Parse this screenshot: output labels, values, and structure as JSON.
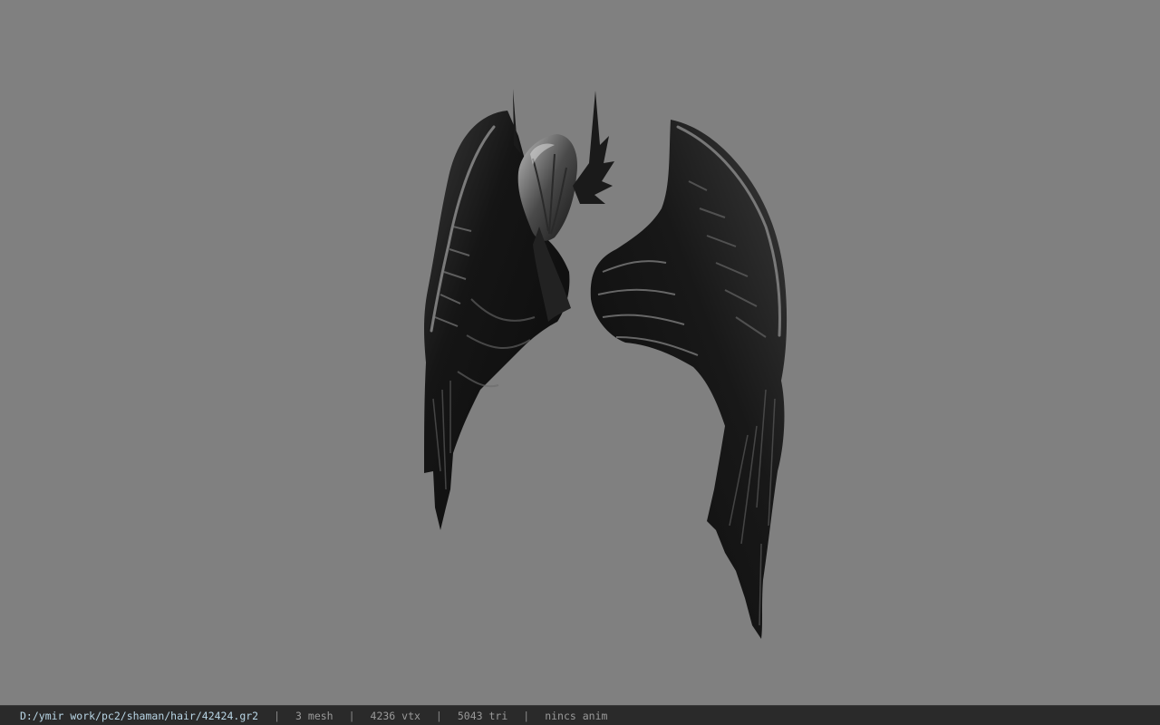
{
  "viewer": {
    "background_color": "#808080",
    "model_icon": "black-feathered-wings-with-helm"
  },
  "status_bar": {
    "file_path": "D:/ymir work/pc2/shaman/hair/42424.gr2",
    "separator": "|",
    "mesh_count": "3 mesh",
    "vertex_count": "4236 vtx",
    "triangle_count": "5043 tri",
    "animation": "nincs anim"
  }
}
